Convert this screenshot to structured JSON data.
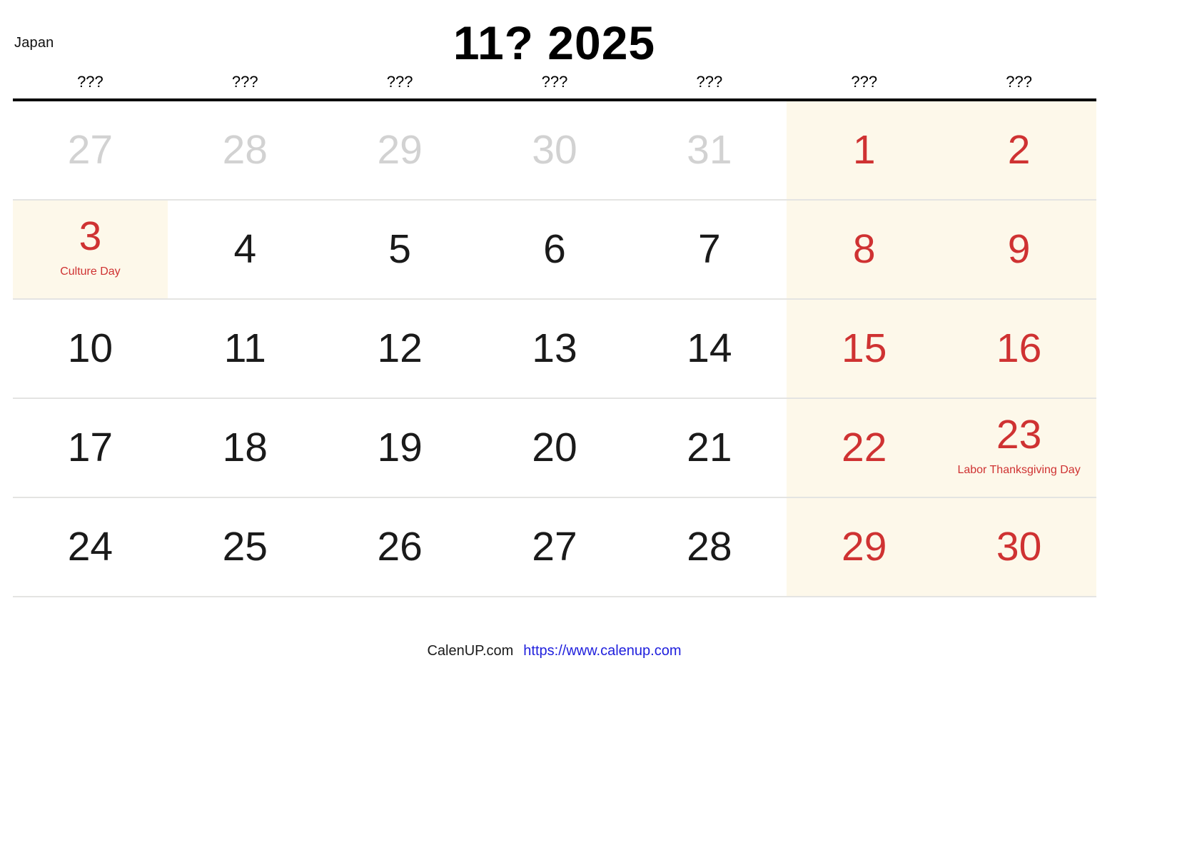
{
  "header": {
    "country": "Japan",
    "title": "11? 2025"
  },
  "weekdays": [
    "???",
    "???",
    "???",
    "???",
    "???",
    "???",
    "???"
  ],
  "colors": {
    "weekend_background": "#fdf8ea",
    "holiday_background": "#fdf8ea",
    "red_text": "#cf3232",
    "muted_text": "#d2d2d2",
    "default_text": "#1a1a1a",
    "rule": "#000000",
    "row_divider": "#e4e4e2",
    "link": "#2020dd"
  },
  "weeks": [
    [
      {
        "num": "27",
        "style": "muted"
      },
      {
        "num": "28",
        "style": "muted"
      },
      {
        "num": "29",
        "style": "muted"
      },
      {
        "num": "30",
        "style": "muted"
      },
      {
        "num": "31",
        "style": "muted"
      },
      {
        "num": "1",
        "style": "weekend"
      },
      {
        "num": "2",
        "style": "weekend"
      }
    ],
    [
      {
        "num": "3",
        "style": "holiday",
        "holiday": "Culture Day"
      },
      {
        "num": "4",
        "style": "normal"
      },
      {
        "num": "5",
        "style": "normal"
      },
      {
        "num": "6",
        "style": "normal"
      },
      {
        "num": "7",
        "style": "normal"
      },
      {
        "num": "8",
        "style": "weekend"
      },
      {
        "num": "9",
        "style": "weekend"
      }
    ],
    [
      {
        "num": "10",
        "style": "normal"
      },
      {
        "num": "11",
        "style": "normal"
      },
      {
        "num": "12",
        "style": "normal"
      },
      {
        "num": "13",
        "style": "normal"
      },
      {
        "num": "14",
        "style": "normal"
      },
      {
        "num": "15",
        "style": "weekend"
      },
      {
        "num": "16",
        "style": "weekend"
      }
    ],
    [
      {
        "num": "17",
        "style": "normal"
      },
      {
        "num": "18",
        "style": "normal"
      },
      {
        "num": "19",
        "style": "normal"
      },
      {
        "num": "20",
        "style": "normal"
      },
      {
        "num": "21",
        "style": "normal"
      },
      {
        "num": "22",
        "style": "weekend"
      },
      {
        "num": "23",
        "style": "weekend",
        "holiday": "Labor Thanksgiving Day"
      }
    ],
    [
      {
        "num": "24",
        "style": "normal"
      },
      {
        "num": "25",
        "style": "normal"
      },
      {
        "num": "26",
        "style": "normal"
      },
      {
        "num": "27",
        "style": "normal"
      },
      {
        "num": "28",
        "style": "normal"
      },
      {
        "num": "29",
        "style": "weekend"
      },
      {
        "num": "30",
        "style": "weekend"
      }
    ]
  ],
  "footer": {
    "brand": "CalenUP.com",
    "url": "https://www.calenup.com"
  }
}
